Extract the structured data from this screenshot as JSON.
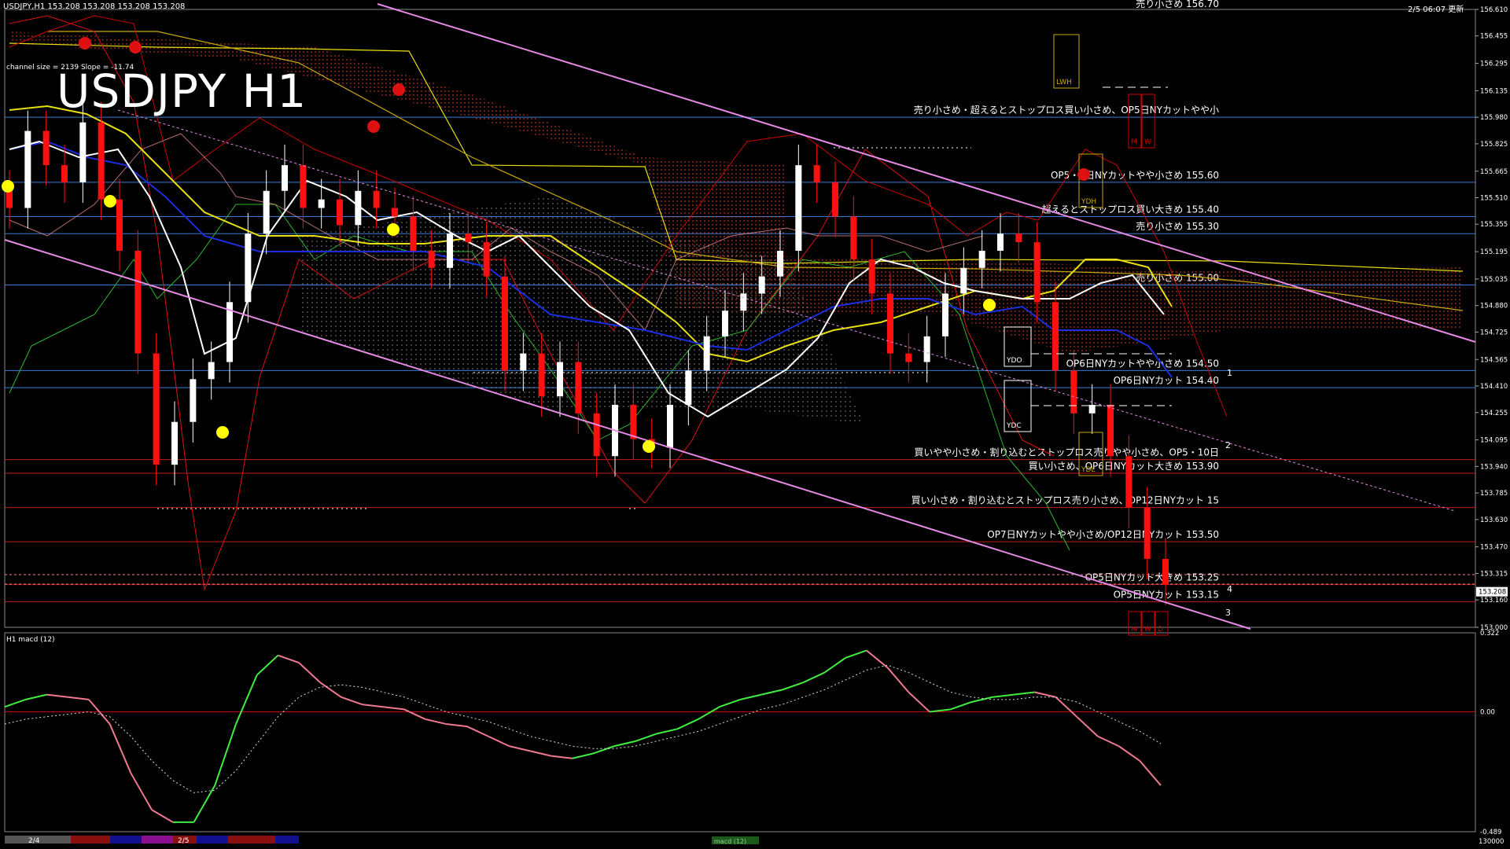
{
  "header": {
    "symbol_line": "USDJPY,H1  153.208 153.208 153.208 153.208",
    "server_time": "2/5 06:07 更新",
    "big_title": "USDJPY H1",
    "channel_info": "channel size = 2139 Slope = -11.74"
  },
  "colors": {
    "background": "#000000",
    "bull_candle": "#ffffff",
    "bear_candle": "#ff1010",
    "level_line_blue": "#3a7bd5",
    "level_line_red": "#c41a1a",
    "channel_line": "#e58ae5",
    "ma_yellow": "#e8e010",
    "ma_white": "#ffffff",
    "ma_blue": "#1a2ee0",
    "macd_main_up": "#40ee40",
    "macd_main_down": "#f07890"
  },
  "chart_data": [
    {
      "type": "line",
      "name": "main_price",
      "title": "USDJPY H1",
      "y_ticks": [
        "156.610",
        "156.455",
        "156.295",
        "156.135",
        "155.980",
        "155.825",
        "155.665",
        "155.510",
        "155.355",
        "155.195",
        "155.035",
        "154.880",
        "154.725",
        "154.565",
        "154.410",
        "154.255",
        "154.095",
        "153.940",
        "153.785",
        "153.630",
        "153.470",
        "153.315",
        "153.160",
        "153.000"
      ],
      "ylim": [
        153.0,
        156.61
      ],
      "current_price": "153.208",
      "price_series": [
        155.45,
        155.9,
        155.7,
        155.6,
        155.95,
        155.5,
        155.2,
        154.6,
        153.95,
        154.2,
        154.45,
        154.55,
        154.9,
        155.3,
        155.55,
        155.7,
        155.45,
        155.5,
        155.35,
        155.55,
        155.45,
        155.4,
        155.2,
        155.1,
        155.3,
        155.25,
        155.05,
        154.5,
        154.6,
        154.35,
        154.55,
        154.25,
        154.0,
        154.3,
        154.1,
        154.05,
        154.3,
        154.5,
        154.7,
        154.85,
        154.95,
        155.05,
        155.2,
        155.7,
        155.6,
        155.4,
        155.15,
        154.95,
        154.6,
        154.55,
        154.7,
        154.95,
        155.1,
        155.2,
        155.3,
        155.25,
        154.9,
        154.5,
        154.25,
        154.3,
        154.0,
        153.7,
        153.4,
        153.25
      ],
      "levels": [
        {
          "label": "売り小さめ・超えるとストップロス買い小さめ、OP5日NYカットやや小",
          "price": 155.98,
          "color": "blue"
        },
        {
          "label": "OP5・6日NYカットやや小さめ 155.60",
          "price": 155.6,
          "color": "blue"
        },
        {
          "label": "超えるとストップロス買い大きめ 155.40",
          "price": 155.4,
          "color": "blue"
        },
        {
          "label": "売り小さめ 155.30",
          "price": 155.3,
          "color": "blue"
        },
        {
          "label": "売り小さめ 155.00",
          "price": 155.0,
          "color": "blue"
        },
        {
          "label": "OP6日NYカットやや小さめ 154.50",
          "price": 154.5,
          "color": "blue"
        },
        {
          "label": "OP6日NYカット 154.40",
          "price": 154.4,
          "color": "blue"
        },
        {
          "label": "買いやや小さめ・割り込むとストップロス売りやや小さめ、OP5・10日",
          "price": 153.98,
          "color": "red"
        },
        {
          "label": "買い小さめ、OP6日NYカット大きめ 153.90",
          "price": 153.9,
          "color": "red"
        },
        {
          "label": "買い小さめ・割り込むとストップロス売り小さめ、OP12日NYカット 15",
          "price": 153.7,
          "color": "red"
        },
        {
          "label": "OP7日NYカットやや小さめ/OP12日NYカット 153.50",
          "price": 153.5,
          "color": "red"
        },
        {
          "label": "OP5日NYカット大きめ 153.25",
          "price": 153.25,
          "color": "red"
        },
        {
          "label": "OP5日NYカット 153.15",
          "price": 153.15,
          "color": "red"
        }
      ],
      "top_cut_label": "売り小さめ 156.70",
      "box_labels": [
        "LWH",
        "M",
        "W",
        "YDH",
        "YDO",
        "YDC",
        "YDL",
        "M",
        "W",
        "D"
      ],
      "channel_numbers": [
        "1",
        "2",
        "4",
        "3"
      ]
    },
    {
      "type": "line",
      "name": "macd",
      "title": "H1  macd (12)",
      "y_ticks": [
        "0.322",
        "0.00",
        "-0.489"
      ],
      "ylim": [
        -0.489,
        0.322
      ],
      "macd": [
        0.02,
        0.05,
        0.07,
        0.06,
        0.05,
        -0.05,
        -0.25,
        -0.4,
        -0.45,
        -0.45,
        -0.3,
        -0.05,
        0.15,
        0.23,
        0.2,
        0.12,
        0.06,
        0.03,
        0.02,
        0.01,
        -0.03,
        -0.05,
        -0.06,
        -0.1,
        -0.14,
        -0.16,
        -0.18,
        -0.19,
        -0.17,
        -0.14,
        -0.12,
        -0.09,
        -0.07,
        -0.03,
        0.02,
        0.05,
        0.07,
        0.09,
        0.12,
        0.16,
        0.22,
        0.25,
        0.18,
        0.08,
        0.0,
        0.01,
        0.04,
        0.06,
        0.07,
        0.08,
        0.06,
        -0.02,
        -0.1,
        -0.14,
        -0.2,
        -0.3
      ],
      "signal": [
        -0.05,
        -0.03,
        -0.02,
        -0.01,
        0.0,
        -0.02,
        -0.1,
        -0.2,
        -0.28,
        -0.33,
        -0.32,
        -0.24,
        -0.13,
        -0.02,
        0.06,
        0.1,
        0.11,
        0.1,
        0.08,
        0.06,
        0.03,
        0.0,
        -0.02,
        -0.04,
        -0.07,
        -0.1,
        -0.12,
        -0.14,
        -0.15,
        -0.15,
        -0.14,
        -0.12,
        -0.1,
        -0.08,
        -0.05,
        -0.02,
        0.01,
        0.03,
        0.06,
        0.09,
        0.13,
        0.17,
        0.19,
        0.16,
        0.12,
        0.08,
        0.06,
        0.05,
        0.05,
        0.06,
        0.06,
        0.04,
        0.0,
        -0.04,
        -0.08,
        -0.13
      ]
    }
  ],
  "time_axis": {
    "labels": [
      "2/4",
      "2/5"
    ],
    "indicator_name": "macd (12)",
    "right_value": "130000"
  }
}
